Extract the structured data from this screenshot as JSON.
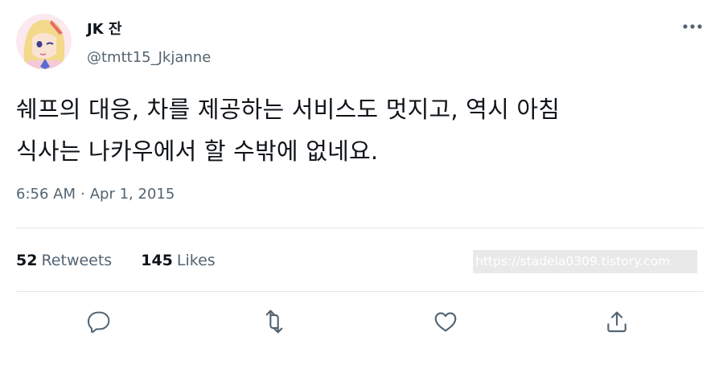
{
  "author": {
    "display_name": "JK 잔",
    "handle": "@tmtt15_Jkjanne",
    "avatar": "anime-avatar"
  },
  "tweet": {
    "line1": "쉐프의 대응, 차를 제공하는 서비스도 멋지고, 역시 아침",
    "line2": "식사는 나카우에서 할 수밖에 없네요.",
    "time": "6:56 AM",
    "separator": "·",
    "date": "Apr 1, 2015"
  },
  "stats": {
    "retweets_count": "52",
    "retweets_label": "Retweets",
    "likes_count": "145",
    "likes_label": "Likes"
  },
  "watermark": "https://stadela0309.tistory.com",
  "icons": {
    "more": "more-dots-icon",
    "reply": "reply-icon",
    "retweet": "retweet-icon",
    "like": "heart-icon",
    "share": "share-icon"
  },
  "colors": {
    "text_primary": "#0f1419",
    "text_secondary": "#536471",
    "divider": "#e4e9ec"
  }
}
